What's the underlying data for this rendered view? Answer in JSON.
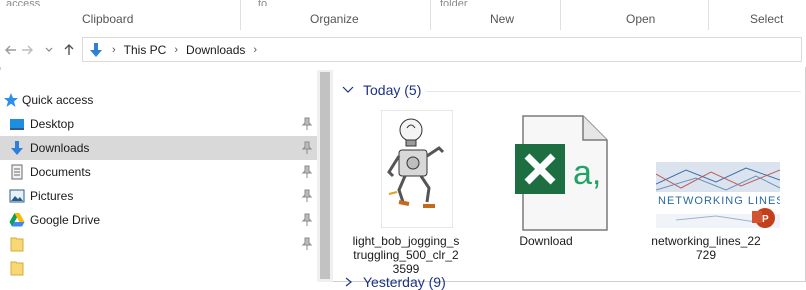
{
  "ribbon": {
    "groups": [
      "Clipboard",
      "Organize",
      "New",
      "Open",
      "Select"
    ],
    "top_cut_texts": [
      "access",
      "to",
      "folder"
    ]
  },
  "address": {
    "crumbs": [
      "This PC",
      "Downloads"
    ]
  },
  "nav": {
    "items": [
      {
        "label": "Quick access",
        "icon": "star-icon"
      },
      {
        "label": "Desktop",
        "icon": "desktop-icon"
      },
      {
        "label": "Downloads",
        "icon": "download-arrow-icon",
        "selected": true
      },
      {
        "label": "Documents",
        "icon": "documents-icon"
      },
      {
        "label": "Pictures",
        "icon": "pictures-icon"
      },
      {
        "label": "Google Drive",
        "icon": "google-drive-icon"
      },
      {
        "label": "",
        "icon": "folder-icon"
      },
      {
        "label": "",
        "icon": "folder-icon"
      }
    ]
  },
  "content": {
    "group_today": "Today (5)",
    "group_yesterday": "Yesterday (9)",
    "files": [
      {
        "name": "light_bob_jogging_struggling_500_clr_23599",
        "type": "image"
      },
      {
        "name": "Download",
        "type": "excel"
      },
      {
        "name": "networking_lines_22729",
        "type": "powerpoint",
        "thumb_text": "NETWORKING LINES"
      }
    ]
  },
  "colors": {
    "accent_blue": "#1e3287",
    "excel_green": "#1d6f42",
    "ppt_red": "#c43e1c",
    "selected_bg": "#d9d9d9"
  }
}
